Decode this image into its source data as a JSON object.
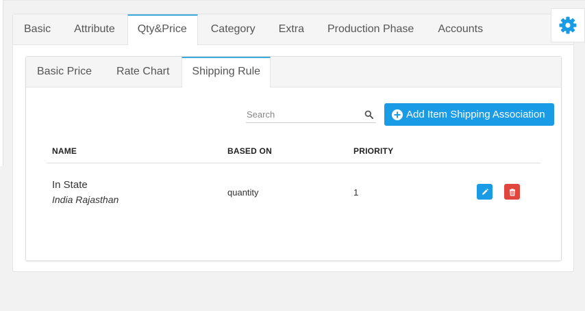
{
  "colors": {
    "accent": "#1a9be6",
    "danger": "#e0453e",
    "active_tab_border": "#3aa9dc"
  },
  "outer_tabs": [
    {
      "label": "Basic",
      "active": false
    },
    {
      "label": "Attribute",
      "active": false
    },
    {
      "label": "Qty&Price",
      "active": true
    },
    {
      "label": "Category",
      "active": false
    },
    {
      "label": "Extra",
      "active": false
    },
    {
      "label": "Production Phase",
      "active": false
    },
    {
      "label": "Accounts",
      "active": false
    }
  ],
  "settings": {
    "icon": "gear-icon"
  },
  "inner_tabs": [
    {
      "label": "Basic Price",
      "active": false
    },
    {
      "label": "Rate Chart",
      "active": false
    },
    {
      "label": "Shipping Rule",
      "active": true
    }
  ],
  "search": {
    "placeholder": "Search",
    "value": "",
    "icon": "search-icon"
  },
  "add_button": {
    "label": "Add Item Shipping Association",
    "icon": "plus-circle-icon"
  },
  "table": {
    "columns": [
      "NAME",
      "BASED ON",
      "PRIORITY"
    ],
    "rows": [
      {
        "name": "In State",
        "subtitle": "India Rajasthan",
        "based_on": "quantity",
        "priority": "1",
        "actions": [
          "pencil-icon",
          "trash-icon"
        ]
      }
    ]
  }
}
